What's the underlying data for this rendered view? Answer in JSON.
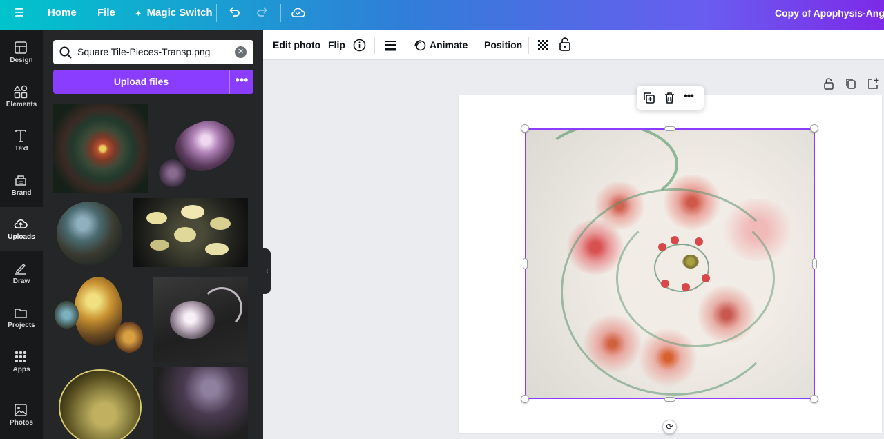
{
  "topbar": {
    "menu_icon": "hamburger-icon",
    "home": "Home",
    "file": "File",
    "magic_switch": "Magic Switch",
    "undo_icon": "undo-icon",
    "redo_icon": "redo-icon",
    "cloud_icon": "cloud-check-icon",
    "doc_title": "Copy of Apophysis-AngelC"
  },
  "sidebar": {
    "items": [
      {
        "label": "Design",
        "icon": "layout-icon"
      },
      {
        "label": "Elements",
        "icon": "shapes-icon"
      },
      {
        "label": "Text",
        "icon": "text-icon"
      },
      {
        "label": "Brand",
        "icon": "brand-kit-icon"
      },
      {
        "label": "Uploads",
        "icon": "cloud-upload-icon"
      },
      {
        "label": "Draw",
        "icon": "pen-icon"
      },
      {
        "label": "Projects",
        "icon": "folder-icon"
      },
      {
        "label": "Apps",
        "icon": "apps-grid-icon"
      },
      {
        "label": "Photos",
        "icon": "image-icon"
      }
    ],
    "active": "Uploads"
  },
  "panel": {
    "search_value": "Square Tile-Pieces-Transp.png",
    "upload_label": "Upload files",
    "more_label": "•••",
    "thumbnails": [
      "fractal-red-spiral",
      "fractal-purple-cluster",
      "fractal-bubble-blue",
      "fractal-yellow-flowers",
      "fractal-gold-bubbles",
      "fractal-silver-swirl",
      "fractal-yellow-sphere",
      "fractal-purple-fan"
    ]
  },
  "toolbar": {
    "edit_photo": "Edit photo",
    "flip": "Flip",
    "info_icon": "info-icon",
    "lines_icon": "border-style-icon",
    "animate": "Animate",
    "position": "Position",
    "transparency_icon": "transparency-icon",
    "lock_icon": "lock-icon"
  },
  "canvas": {
    "page_lock_icon": "lock-icon",
    "duplicate_page_icon": "duplicate-icon",
    "add_page_icon": "add-page-icon",
    "floating_duplicate_icon": "duplicate-icon",
    "floating_delete_icon": "trash-icon",
    "floating_more_icon": "more-icon",
    "rotate_icon": "rotate-icon"
  },
  "colors": {
    "accent": "#8b3dff",
    "rail_bg": "#18191b",
    "panel_bg": "#252627",
    "canvas_bg": "#ebecf0"
  }
}
